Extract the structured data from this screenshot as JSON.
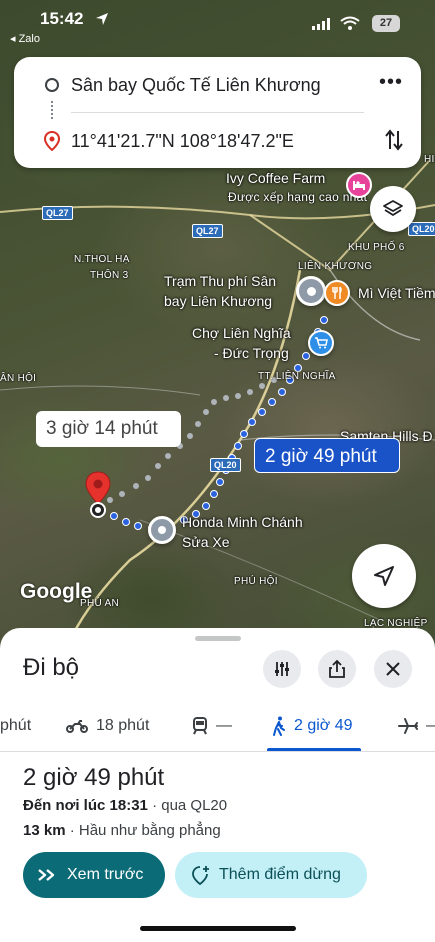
{
  "status_bar": {
    "time": "15:42",
    "back_app": "◂ Zalo",
    "battery": "27"
  },
  "search": {
    "origin": "Sân bay Quốc Tế Liên Khương",
    "destination": "11°41'21.7\"N 108°18'47.2\"E"
  },
  "map": {
    "labels": {
      "ivy": "Ivy Coffee Farm",
      "ivy_sub": "Được xếp hạng cao nhất",
      "tram": "Trạm Thu phí Sân",
      "tram2": "bay Liên Khương",
      "mi_viet": "Mì Việt Tiềm",
      "cho": "Chợ Liên Nghĩa",
      "cho2": "- Đức Trọng",
      "honda": "Honda Minh Chánh",
      "honda2": "Sửa Xe",
      "samten": "Samten Hills Đ",
      "n_thol_ha": "N.THOL HẠ",
      "thon3": "THÔN 3",
      "lien_khuong": "LIÊN KHƯƠNG",
      "khu_pho6": "KHU PHỐ 6",
      "tt_lien_nghia": "TT. LIÊN NGHĨA",
      "an_hoi": "ÂN HỘI",
      "phu_hoi": "PHÚ HỘI",
      "phu_an": "PHÚ AN",
      "lac_nghiep": "LẠC NGHIỆP",
      "hi": "HI"
    },
    "shields": {
      "ql27_a": "QL27",
      "ql27_b": "QL27",
      "ql20_a": "QL20",
      "ql20_b": "QL20"
    },
    "callout_walk_alt": "3 giờ 14 phút",
    "callout_walk_main": "2 giờ 49 phút",
    "google": "Google"
  },
  "sheet": {
    "title": "Đi bộ",
    "modes": [
      {
        "icon": "transit-partial",
        "label": "phút"
      },
      {
        "icon": "motorbike-icon",
        "label": "18 phút"
      },
      {
        "icon": "train-icon",
        "label": "—"
      },
      {
        "icon": "walk-icon",
        "label": "2 giờ 49",
        "active": true
      },
      {
        "icon": "plane-icon",
        "label": "—"
      }
    ],
    "duration": "2 giờ 49 phút",
    "arrive_prefix": "Đến nơi lúc",
    "arrive_time": "18:31",
    "arrive_via": "· qua QL20",
    "distance": "13 km",
    "terrain": "· Hầu như bằng phẳng",
    "preview_label": "Xem trước",
    "add_stop_label": "Thêm điểm dừng"
  },
  "colors": {
    "route_blue": "#1a53c7",
    "preview_bg": "#0b6b76",
    "add_stop_bg": "#c3f0f7",
    "active_mode": "#0b57d0"
  }
}
